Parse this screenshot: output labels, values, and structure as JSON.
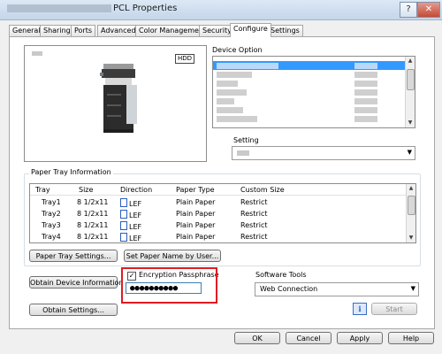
{
  "window": {
    "title": "PCL Properties",
    "help_glyph": "?",
    "close_glyph": "✕"
  },
  "tabs": [
    "General",
    "Sharing",
    "Ports",
    "Advanced",
    "Color Management",
    "Security",
    "Configure",
    "Settings"
  ],
  "active_tab": "Configure",
  "preview": {
    "hdd_label": "HDD"
  },
  "device_option": {
    "label": "Device Option"
  },
  "setting": {
    "label": "Setting"
  },
  "paper_tray": {
    "group_title": "Paper Tray Information",
    "columns": [
      "Tray",
      "Size",
      "Direction",
      "Paper Type",
      "Custom Size"
    ],
    "rows": [
      [
        "Tray1",
        "8 1/2x11",
        "LEF",
        "Plain Paper",
        "Restrict"
      ],
      [
        "Tray2",
        "8 1/2x11",
        "LEF",
        "Plain Paper",
        "Restrict"
      ],
      [
        "Tray3",
        "8 1/2x11",
        "LEF",
        "Plain Paper",
        "Restrict"
      ],
      [
        "Tray4",
        "8 1/2x11",
        "LEF",
        "Plain Paper",
        "Restrict"
      ]
    ],
    "settings_button": "Paper Tray Settings...",
    "set_name_button": "Set Paper Name by User..."
  },
  "device_info_button": "Obtain Device Information",
  "obtain_settings_button": "Obtain Settings...",
  "encryption": {
    "label": "Encryption Passphrase",
    "checked": true,
    "value": "●●●●●●●●●●"
  },
  "software_tools": {
    "label": "Software Tools",
    "selected": "Web Connection",
    "start_button": "Start",
    "info_glyph": "i"
  },
  "footer": {
    "ok": "OK",
    "cancel": "Cancel",
    "apply": "Apply",
    "help": "Help"
  }
}
